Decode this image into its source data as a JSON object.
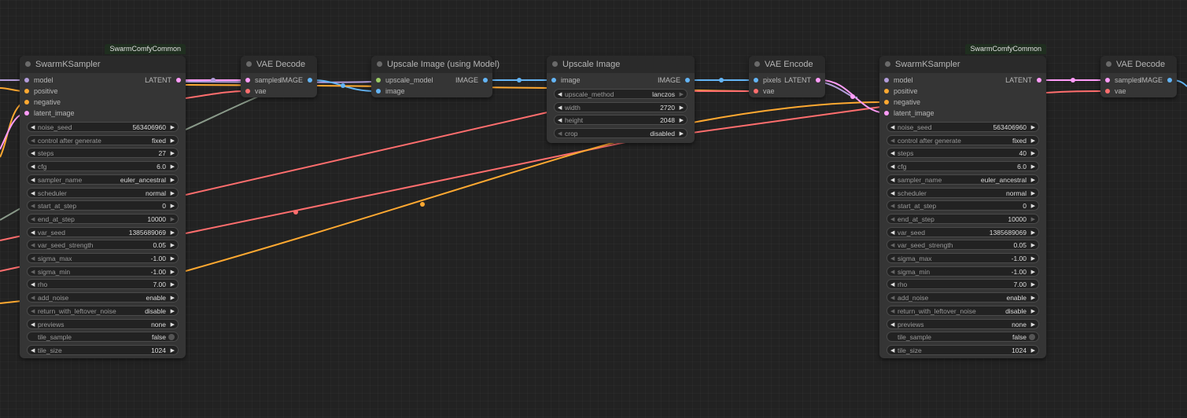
{
  "colors": {
    "canvas": "#222222",
    "node_body": "#353535",
    "node_title": "#2a2a2a",
    "model": "#b39ddb",
    "conditioning": "#ffa931",
    "latent": "#ff9cf9",
    "vae": "#ff6e6e",
    "image": "#64b5f6",
    "upscale_model": "#9ccc65",
    "wire_gray": "#8a9a8a"
  },
  "nodes": {
    "ksampler1": {
      "group": "SwarmComfyCommon",
      "title": "SwarmKSampler",
      "inputs": [
        "model",
        "positive",
        "negative",
        "latent_image"
      ],
      "output": "LATENT",
      "widgets": [
        {
          "name": "noise_seed",
          "value": "563406960"
        },
        {
          "name": "control after generate",
          "value": "fixed"
        },
        {
          "name": "steps",
          "value": "27"
        },
        {
          "name": "cfg",
          "value": "6.0"
        },
        {
          "name": "sampler_name",
          "value": "euler_ancestral"
        },
        {
          "name": "scheduler",
          "value": "normal"
        },
        {
          "name": "start_at_step",
          "value": "0"
        },
        {
          "name": "end_at_step",
          "value": "10000"
        },
        {
          "name": "var_seed",
          "value": "1385689069"
        },
        {
          "name": "var_seed_strength",
          "value": "0.05"
        },
        {
          "name": "sigma_max",
          "value": "-1.00"
        },
        {
          "name": "sigma_min",
          "value": "-1.00"
        },
        {
          "name": "rho",
          "value": "7.00"
        },
        {
          "name": "add_noise",
          "value": "enable"
        },
        {
          "name": "return_with_leftover_noise",
          "value": "disable"
        },
        {
          "name": "previews",
          "value": "none"
        },
        {
          "name": "tile_sample",
          "value": "false"
        },
        {
          "name": "tile_size",
          "value": "1024"
        }
      ]
    },
    "vae_decode1": {
      "title": "VAE Decode",
      "inputs": [
        "samples",
        "vae"
      ],
      "output": "IMAGE"
    },
    "upscale_model": {
      "title": "Upscale Image (using Model)",
      "inputs": [
        "upscale_model",
        "image"
      ],
      "output": "IMAGE"
    },
    "upscale_image": {
      "title": "Upscale Image",
      "inputs": [
        "image"
      ],
      "output": "IMAGE",
      "widgets": [
        {
          "name": "upscale_method",
          "value": "lanczos"
        },
        {
          "name": "width",
          "value": "2720"
        },
        {
          "name": "height",
          "value": "2048"
        },
        {
          "name": "crop",
          "value": "disabled"
        }
      ]
    },
    "vae_encode": {
      "title": "VAE Encode",
      "inputs": [
        "pixels",
        "vae"
      ],
      "output": "LATENT"
    },
    "ksampler2": {
      "group": "SwarmComfyCommon",
      "title": "SwarmKSampler",
      "inputs": [
        "model",
        "positive",
        "negative",
        "latent_image"
      ],
      "output": "LATENT",
      "widgets": [
        {
          "name": "noise_seed",
          "value": "563406960"
        },
        {
          "name": "control after generate",
          "value": "fixed"
        },
        {
          "name": "steps",
          "value": "40"
        },
        {
          "name": "cfg",
          "value": "6.0"
        },
        {
          "name": "sampler_name",
          "value": "euler_ancestral"
        },
        {
          "name": "scheduler",
          "value": "normal"
        },
        {
          "name": "start_at_step",
          "value": "0"
        },
        {
          "name": "end_at_step",
          "value": "10000"
        },
        {
          "name": "var_seed",
          "value": "1385689069"
        },
        {
          "name": "var_seed_strength",
          "value": "0.05"
        },
        {
          "name": "sigma_max",
          "value": "-1.00"
        },
        {
          "name": "sigma_min",
          "value": "-1.00"
        },
        {
          "name": "rho",
          "value": "7.00"
        },
        {
          "name": "add_noise",
          "value": "enable"
        },
        {
          "name": "return_with_leftover_noise",
          "value": "disable"
        },
        {
          "name": "previews",
          "value": "none"
        },
        {
          "name": "tile_sample",
          "value": "false"
        },
        {
          "name": "tile_size",
          "value": "1024"
        }
      ]
    },
    "vae_decode2": {
      "title": "VAE Decode",
      "inputs": [
        "samples",
        "vae"
      ],
      "output": "IMAGE"
    }
  }
}
